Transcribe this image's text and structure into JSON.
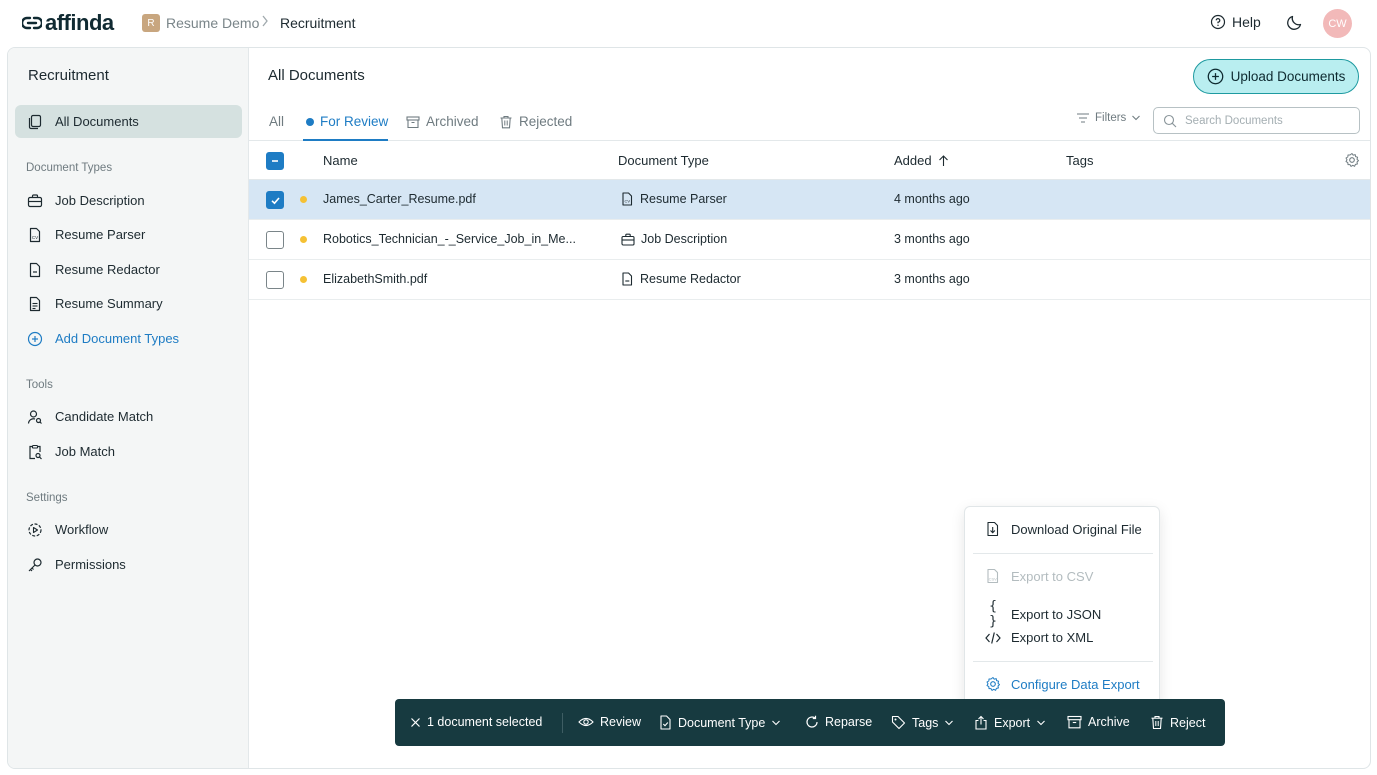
{
  "brand": {
    "name": "affinda"
  },
  "breadcrumb": {
    "workspace_initial": "R",
    "workspace": "Resume Demo",
    "current": "Recruitment"
  },
  "header": {
    "help_label": "Help",
    "avatar_initials": "CW"
  },
  "sidebar": {
    "title": "Recruitment",
    "all_documents": "All Documents",
    "sections": {
      "document_types": "Document Types",
      "tools": "Tools",
      "settings": "Settings"
    },
    "document_types": [
      "Job Description",
      "Resume Parser",
      "Resume Redactor",
      "Resume Summary"
    ],
    "add_document_types": "Add Document Types",
    "tools": [
      "Candidate Match",
      "Job Match"
    ],
    "settings": [
      "Workflow",
      "Permissions"
    ]
  },
  "main": {
    "title": "All Documents",
    "upload_label": "Upload Documents",
    "tabs": [
      "All",
      "For Review",
      "Archived",
      "Rejected"
    ],
    "active_tab": "For Review",
    "filters_label": "Filters",
    "search_placeholder": "Search Documents"
  },
  "table": {
    "columns": [
      "Name",
      "Document Type",
      "Added",
      "Tags"
    ],
    "rows": [
      {
        "name": "James_Carter_Resume.pdf",
        "type": "Resume Parser",
        "added": "4 months ago",
        "selected": true
      },
      {
        "name": "Robotics_Technician_-_Service_Job_in_Me...",
        "type": "Job Description",
        "added": "3 months ago",
        "selected": false
      },
      {
        "name": "ElizabethSmith.pdf",
        "type": "Resume Redactor",
        "added": "3 months ago",
        "selected": false
      }
    ]
  },
  "export_menu": {
    "download_original": "Download Original File",
    "export_csv": "Export to CSV",
    "export_json": "Export to JSON",
    "export_xml": "Export to XML",
    "configure": "Configure Data Export"
  },
  "action_bar": {
    "selected_text": "1 document selected",
    "review": "Review",
    "document_type": "Document Type",
    "reparse": "Reparse",
    "tags": "Tags",
    "export": "Export",
    "archive": "Archive",
    "reject": "Reject"
  },
  "colors": {
    "accent": "#1e7cc4",
    "upload_bg": "#b9eef0",
    "action_bar_bg": "#173a40",
    "selected_row": "#d6e6f4",
    "status_dot": "#f5c134",
    "avatar": "#f2b9b9"
  }
}
